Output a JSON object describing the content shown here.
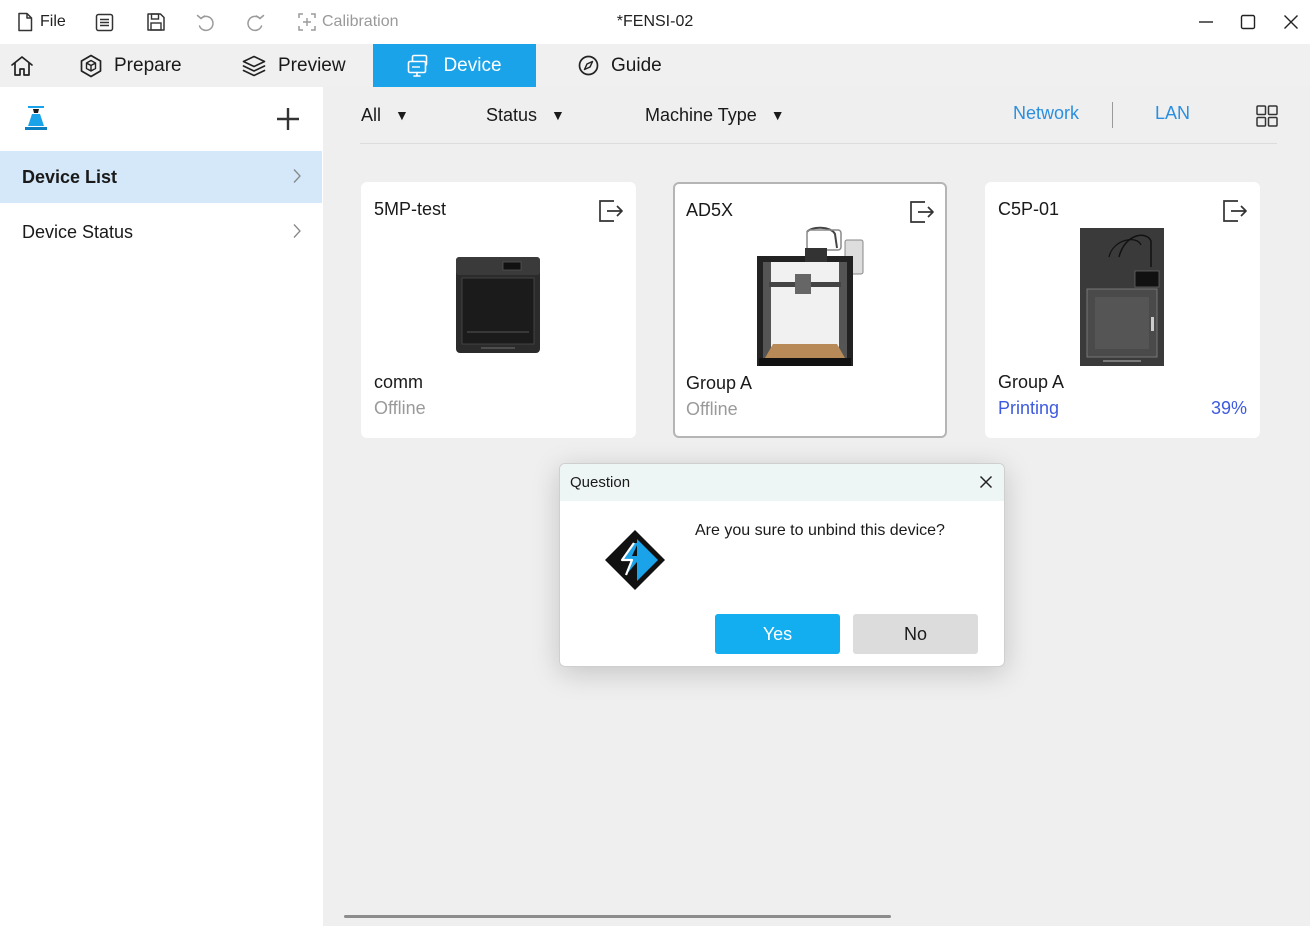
{
  "titlebar": {
    "file_label": "File",
    "calibration_label": "Calibration",
    "window_title": "*FENSI-02"
  },
  "nav": {
    "tabs": [
      {
        "label": "Prepare"
      },
      {
        "label": "Preview"
      },
      {
        "label": "Device",
        "active": true
      },
      {
        "label": "Guide"
      }
    ]
  },
  "sidebar": {
    "items": [
      {
        "label": "Device List",
        "active": true
      },
      {
        "label": "Device Status"
      }
    ]
  },
  "filters": {
    "all_label": "All",
    "status_label": "Status",
    "machine_type_label": "Machine Type",
    "network_label": "Network",
    "lan_label": "LAN"
  },
  "devices": [
    {
      "name": "5MP-test",
      "group": "comm",
      "status": "Offline"
    },
    {
      "name": "AD5X",
      "group": "Group A",
      "status": "Offline"
    },
    {
      "name": "C5P-01",
      "group": "Group A",
      "status": "Printing",
      "progress": "39%"
    }
  ],
  "dialog": {
    "title": "Question",
    "message": "Are you sure to unbind this device?",
    "yes_label": "Yes",
    "no_label": "No"
  },
  "colors": {
    "accent": "#1aa3e8",
    "link": "#2a8fe0",
    "printing": "#3d5ae0",
    "yes_button": "#12aef0"
  },
  "icons": [
    "file-icon",
    "document-icon",
    "save-icon",
    "undo-icon",
    "redo-icon",
    "calibration-icon",
    "minimize-icon",
    "maximize-icon",
    "close-icon",
    "home-icon",
    "prepare-icon",
    "layers-icon",
    "device-icon",
    "compass-icon",
    "brand-icon",
    "add-icon",
    "chevron-right-icon",
    "grid-view-icon",
    "unbind-icon",
    "flashforge-logo"
  ]
}
